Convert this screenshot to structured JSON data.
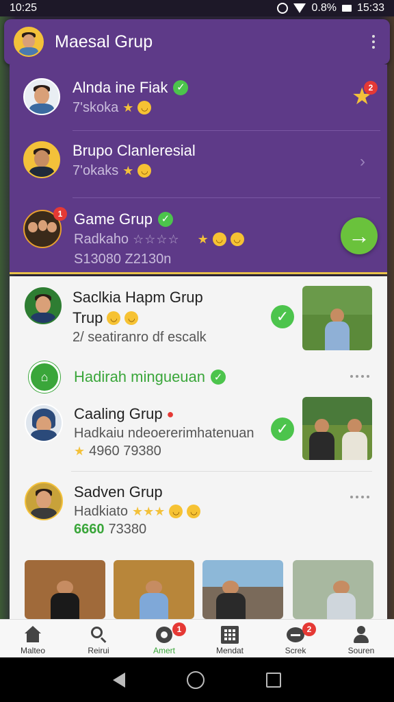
{
  "status_bar": {
    "time": "10:25",
    "battery": "0.8%",
    "clock": "15:33"
  },
  "header": {
    "title": "Maesal Grup"
  },
  "featured": [
    {
      "name": "Alnda ine Fiak",
      "sub": "7'skoka"
    },
    {
      "name": "Brupo Clanleresial",
      "sub": "7'okaks"
    },
    {
      "name": "Game Grup",
      "sub": "Radkaho",
      "stats": "S13080 Z2130n",
      "badge": "1"
    }
  ],
  "star_badge": "2",
  "groups": [
    {
      "name": "Saclkia Hapm Grup",
      "line2": "Trup",
      "sub": "2/ seatiranro df escalk"
    },
    {
      "name": "Hadirah mingueuan"
    },
    {
      "name": "Caaling Grup",
      "sub": "Hadkaiu ndeoererimhatenuan",
      "stats": "4960 79380"
    },
    {
      "name": "Sadven Grup",
      "sub": "Hadkiato",
      "stats_green": "6660",
      "stats": "73380"
    }
  ],
  "bottom_nav": [
    {
      "label": "Malteo",
      "icon": "home-icon"
    },
    {
      "label": "Reirui",
      "icon": "search-icon"
    },
    {
      "label": "Amert",
      "icon": "gear-icon",
      "badge": "1"
    },
    {
      "label": "Mendat",
      "icon": "grid-icon"
    },
    {
      "label": "Screk",
      "icon": "chat-icon",
      "badge": "2"
    },
    {
      "label": "Souren",
      "icon": "profile-icon"
    }
  ],
  "colors": {
    "purple": "#5e3a88",
    "green": "#3aa63a",
    "badge": "#e53935"
  }
}
